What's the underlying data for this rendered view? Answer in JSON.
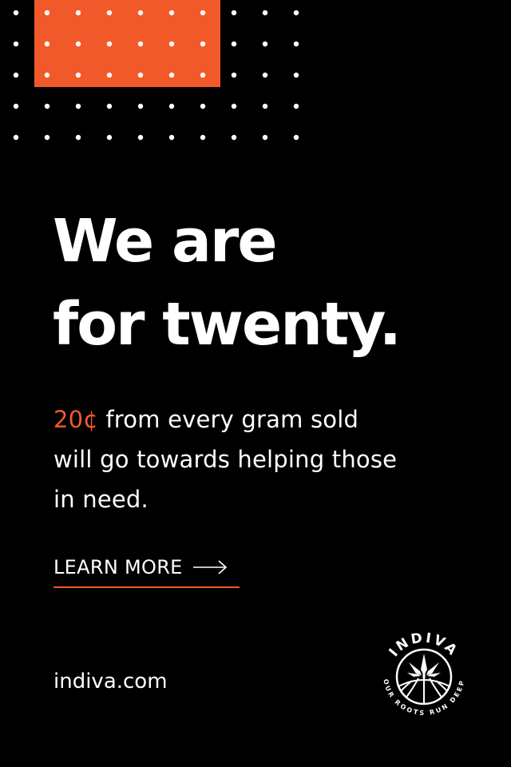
{
  "ad": {
    "headline_line1": "We are",
    "headline_line2": "for twenty.",
    "body_accent": "20¢",
    "body_line1_rest": " from every gram sold",
    "body_line2": "will go towards helping those",
    "body_line3": "in need.",
    "cta_label": "LEARN MORE",
    "cta_icon": "arrow-right-icon",
    "url": "indiva.com"
  },
  "logo": {
    "brand": "INDIVA",
    "tagline": "OUR ROOTS RUN DEEP"
  },
  "colors": {
    "background": "#000000",
    "accent": "#f2592a",
    "text": "#ffffff"
  }
}
